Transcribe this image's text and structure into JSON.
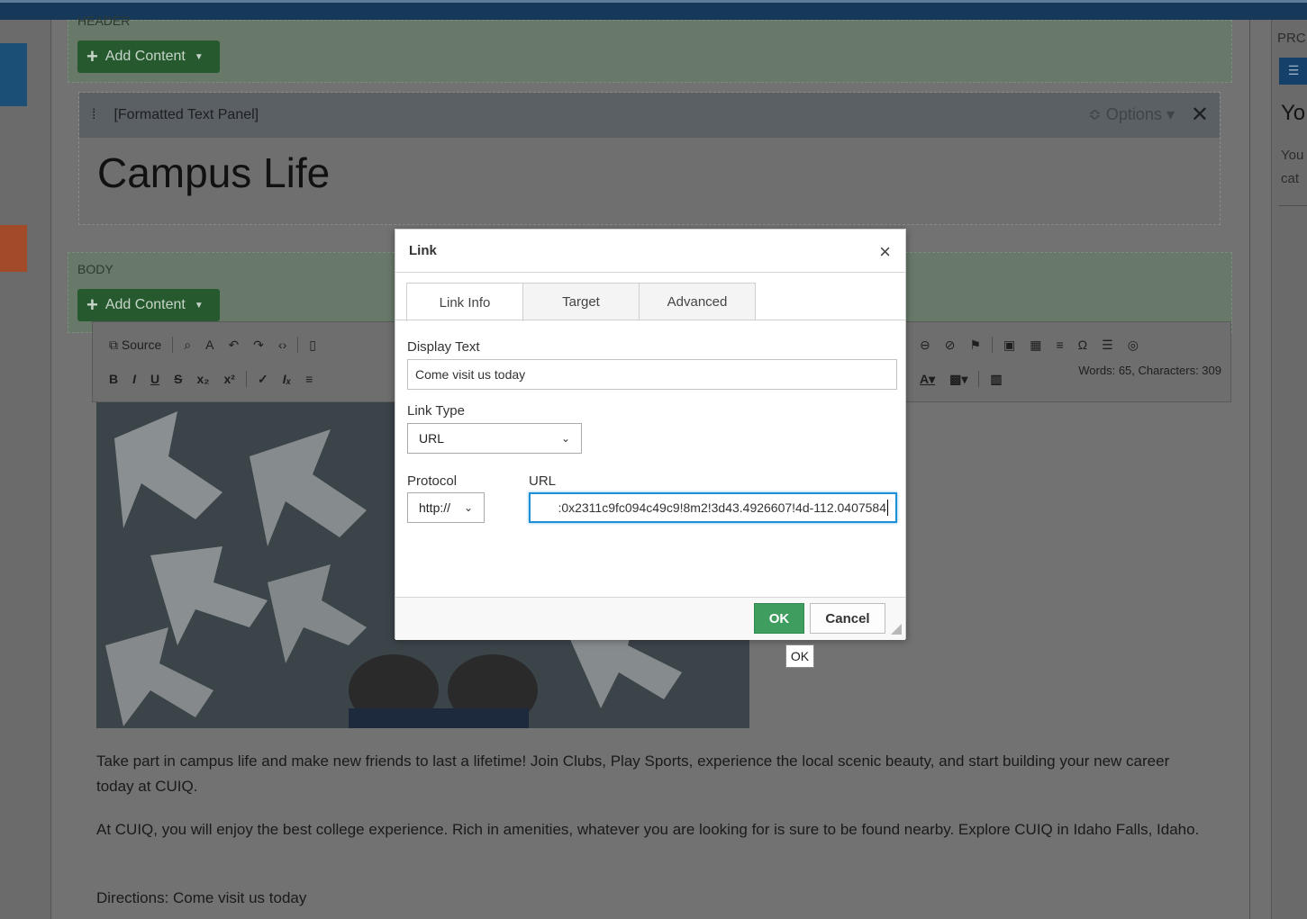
{
  "header_region": {
    "label": "HEADER",
    "add_content": "Add Content"
  },
  "panel": {
    "name": "[Formatted Text Panel]",
    "options": "Options",
    "close": "✕",
    "title": "Campus Life"
  },
  "body_region": {
    "label": "BODY",
    "add_content": "Add Content"
  },
  "editor": {
    "source_label": "Source",
    "word_count": "Words: 65, Characters: 309"
  },
  "content": {
    "paragraph1": "Take part in campus life and make new friends to last a lifetime!  Join Clubs, Play Sports, experience the local scenic beauty, and start building your new career today at CUIQ.",
    "paragraph2": "At CUIQ, you will enjoy the best college experience. Rich in amenities, whatever you are looking for is sure to be found nearby.  Explore CUIQ in Idaho Falls, Idaho.",
    "paragraph3": "Directions:  Come visit us today"
  },
  "right_panel": {
    "pr": "PRC",
    "yo": "Yo",
    "line1": "You",
    "line2": "cat"
  },
  "dialog": {
    "title": "Link",
    "close": "×",
    "tabs": [
      "Link Info",
      "Target",
      "Advanced"
    ],
    "display_text_label": "Display Text",
    "display_text_value": "Come visit us today",
    "link_type_label": "Link Type",
    "link_type_value": "URL",
    "protocol_label": "Protocol",
    "protocol_value": "http://",
    "url_label": "URL",
    "url_value": ":0x2311c9fc094c49c9!8m2!3d43.4926607!4d-112.0407584",
    "ok": "OK",
    "cancel": "Cancel"
  },
  "tooltip": "OK"
}
